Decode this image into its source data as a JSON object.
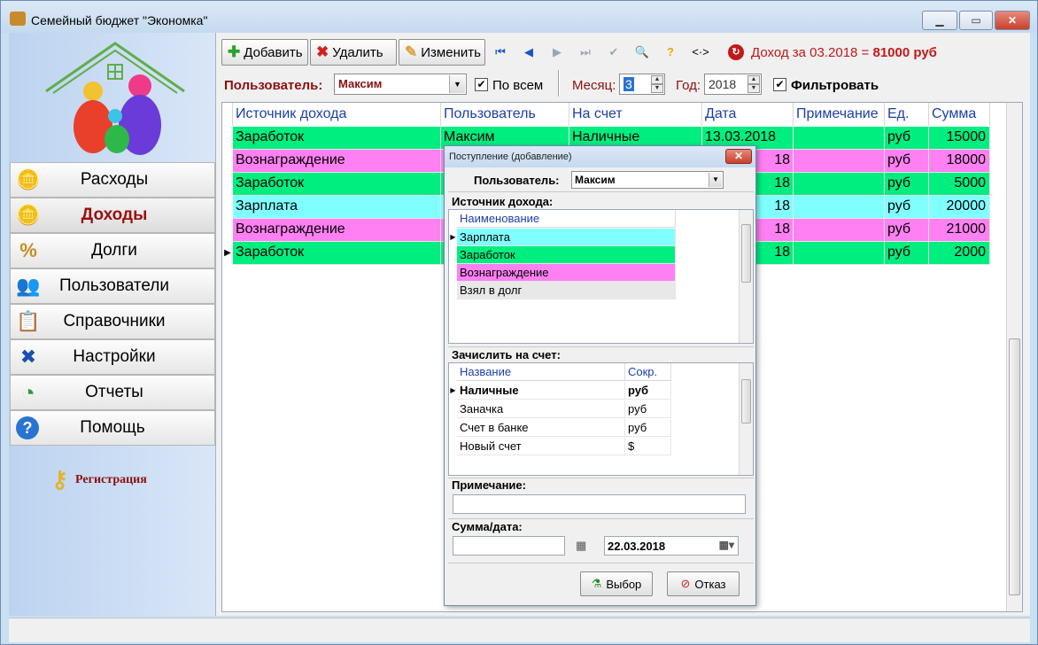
{
  "window": {
    "title": "Семейный бюджет \"Экономка\"",
    "minimize": "▁",
    "maximize": "▭",
    "close": "✕"
  },
  "sidebar": {
    "items": [
      {
        "label": "Расходы",
        "icon": "coins-minus-icon",
        "glyph": "🪙"
      },
      {
        "label": "Доходы",
        "icon": "coins-plus-icon",
        "glyph": "🪙"
      },
      {
        "label": "Долги",
        "icon": "percent-icon",
        "glyph": "%"
      },
      {
        "label": "Пользователи",
        "icon": "users-icon",
        "glyph": "👥"
      },
      {
        "label": "Справочники",
        "icon": "checklist-icon",
        "glyph": "📋"
      },
      {
        "label": "Настройки",
        "icon": "tools-icon",
        "glyph": "✖"
      },
      {
        "label": "Отчеты",
        "icon": "pie-chart-icon",
        "glyph": "◔"
      },
      {
        "label": "Помощь",
        "icon": "help-icon",
        "glyph": "?"
      }
    ],
    "active_index": 1,
    "registration": "Регистрация"
  },
  "toolbar": {
    "add": "Добавить",
    "delete": "Удалить",
    "edit": "Изменить",
    "nav": {
      "first": "⏮",
      "prev": "◀",
      "next": "▶",
      "last": "⏭",
      "confirm": "✔",
      "search": "🔍",
      "help": "?",
      "expand": "<·>"
    },
    "income_label": "Доход за 03.2018 =",
    "income_value": "81000 руб"
  },
  "filter": {
    "user_label": "Пользователь:",
    "user_value": "Максим",
    "all_label": "По всем",
    "all_checked": true,
    "month_label": "Месяц:",
    "month_value": "3",
    "year_label": "Год:",
    "year_value": "2018",
    "filter_label": "Фильтровать",
    "filter_checked": true
  },
  "table": {
    "columns": [
      "Источник дохода",
      "Пользователь",
      "На счет",
      "Дата",
      "Примечание",
      "Ед.",
      "Сумма"
    ],
    "rows": [
      {
        "source": "Заработок",
        "user": "Максим",
        "account": "Наличные",
        "date": "13.03.2018",
        "note": "",
        "unit": "руб",
        "amount": "15000",
        "color": "#00ee80"
      },
      {
        "source": "Вознаграждение",
        "user": "",
        "account": "",
        "date": "18",
        "note": "",
        "unit": "руб",
        "amount": "18000",
        "color": "#ff80f2"
      },
      {
        "source": "Заработок",
        "user": "",
        "account": "",
        "date": "18",
        "note": "",
        "unit": "руб",
        "amount": "5000",
        "color": "#00ee80"
      },
      {
        "source": "Зарплата",
        "user": "",
        "account": "",
        "date": "18",
        "note": "",
        "unit": "руб",
        "amount": "20000",
        "color": "#80ffff"
      },
      {
        "source": "Вознаграждение",
        "user": "",
        "account": "",
        "date": "18",
        "note": "",
        "unit": "руб",
        "amount": "21000",
        "color": "#ff80f2"
      },
      {
        "source": "Заработок",
        "user": "",
        "account": "",
        "date": "18",
        "note": "",
        "unit": "руб",
        "amount": "2000",
        "color": "#00ee80"
      }
    ],
    "current_row": 5
  },
  "dialog": {
    "title": "Поступление (добавление)",
    "close": "✕",
    "user_label": "Пользователь:",
    "user_value": "Максим",
    "source_label": "Источник дохода:",
    "source_header": "Наименование",
    "sources": [
      {
        "name": "Зарплата",
        "color": "#80ffff"
      },
      {
        "name": "Заработок",
        "color": "#00ee80"
      },
      {
        "name": "Вознаграждение",
        "color": "#ff80f2"
      },
      {
        "name": "Взял в долг",
        "color": "#e8e8e8"
      }
    ],
    "account_label": "Зачислить на счет:",
    "account_headers": [
      "Название",
      "Сокр."
    ],
    "accounts": [
      {
        "name": "Наличные",
        "abbr": "руб"
      },
      {
        "name": "Заначка",
        "abbr": "руб"
      },
      {
        "name": "Счет в банке",
        "abbr": "руб"
      },
      {
        "name": "Новый счет",
        "abbr": "$"
      }
    ],
    "note_label": "Примечание:",
    "note_value": "",
    "sum_label": "Сумма/дата:",
    "sum_value": "",
    "date_value": "22.03.2018",
    "ok_button": "Выбор",
    "cancel_button": "Отказ"
  }
}
